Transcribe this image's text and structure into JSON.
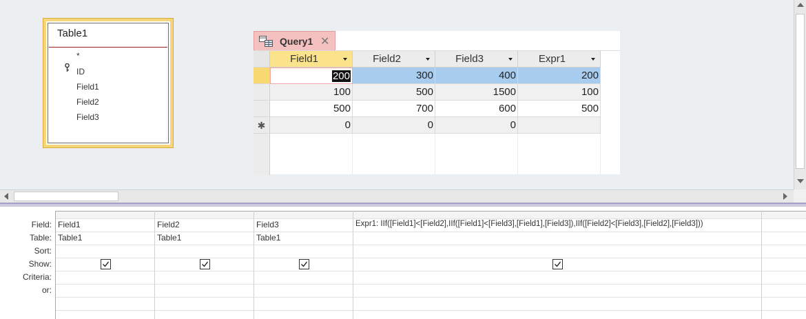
{
  "table_box": {
    "title": "Table1",
    "fields": [
      "*",
      "ID",
      "Field1",
      "Field2",
      "Field3"
    ]
  },
  "query_tab": {
    "label": "Query1",
    "close_glyph": "✕"
  },
  "datasheet": {
    "columns": [
      "Field1",
      "Field2",
      "Field3",
      "Expr1"
    ],
    "rows": [
      [
        "200",
        "300",
        "400",
        "200"
      ],
      [
        "100",
        "500",
        "1500",
        "100"
      ],
      [
        "500",
        "700",
        "600",
        "500"
      ]
    ],
    "new_row": [
      "0",
      "0",
      "0",
      ""
    ],
    "new_row_marker": "✱"
  },
  "design_grid": {
    "row_labels": [
      "Field:",
      "Table:",
      "Sort:",
      "Show:",
      "Criteria:",
      "or:"
    ],
    "columns": [
      {
        "field": "Field1",
        "table": "Table1",
        "show": true
      },
      {
        "field": "Field2",
        "table": "Table1",
        "show": true
      },
      {
        "field": "Field3",
        "table": "Table1",
        "show": true
      },
      {
        "field": "Expr1: IIf([Field1]<[Field2],IIf([Field1]<[Field3],[Field1],[Field3]),IIf([Field2]<[Field3],[Field2],[Field3]))",
        "table": "",
        "show": true
      }
    ]
  },
  "colors": {
    "active_header": "#fbe38c",
    "selected_row": "#a7ccee",
    "tab": "#f5c0c0",
    "table_border": "#f7d67a"
  }
}
